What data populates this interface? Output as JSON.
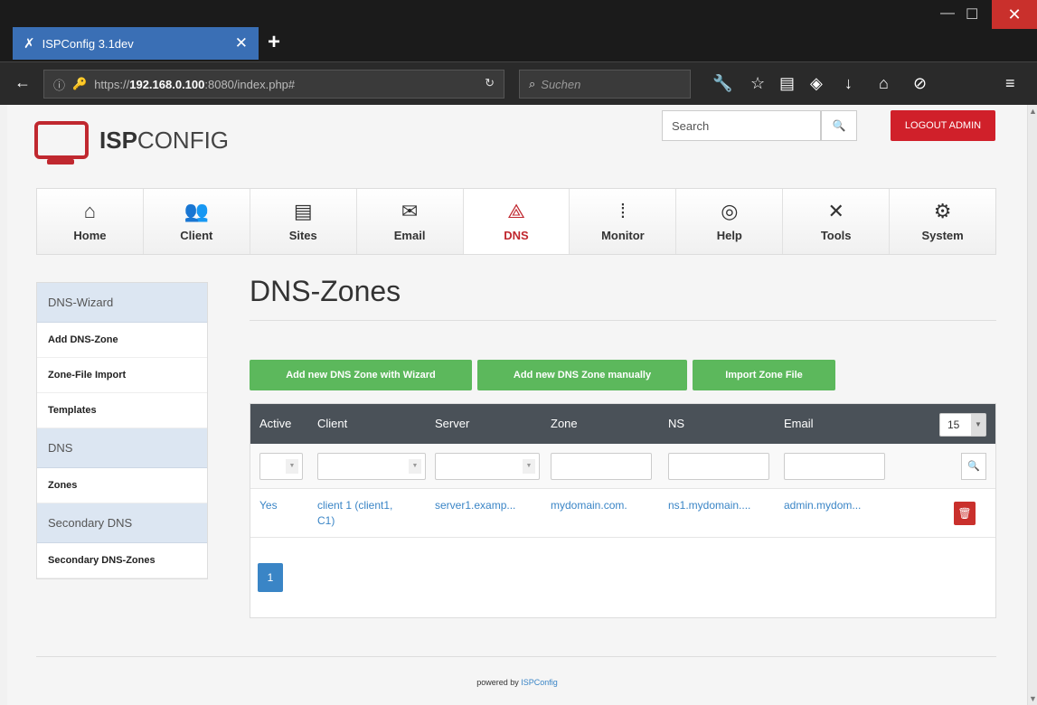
{
  "browser": {
    "tab_title": "ISPConfig 3.1dev",
    "url_prefix": "https://",
    "url_host": "192.168.0.100",
    "url_rest": ":8080/index.php#",
    "search_placeholder": "Suchen",
    "accent": "#3a6fb5"
  },
  "header": {
    "logo_bold": "ISP",
    "logo_rest": "CONFIG",
    "search_placeholder": "Search",
    "logout_label": "LOGOUT ADMIN"
  },
  "nav": {
    "items": [
      {
        "label": "Home",
        "icon": "home-icon"
      },
      {
        "label": "Client",
        "icon": "client-icon"
      },
      {
        "label": "Sites",
        "icon": "sites-icon"
      },
      {
        "label": "Email",
        "icon": "email-icon"
      },
      {
        "label": "DNS",
        "icon": "dns-icon",
        "active": true
      },
      {
        "label": "Monitor",
        "icon": "monitor-icon"
      },
      {
        "label": "Help",
        "icon": "help-icon"
      },
      {
        "label": "Tools",
        "icon": "tools-icon"
      },
      {
        "label": "System",
        "icon": "system-icon"
      }
    ]
  },
  "sidebar": {
    "sections": [
      {
        "heading": "DNS-Wizard",
        "items": [
          "Add DNS-Zone",
          "Zone-File Import",
          "Templates"
        ]
      },
      {
        "heading": "DNS",
        "items": [
          "Zones"
        ]
      },
      {
        "heading": "Secondary DNS",
        "items": [
          "Secondary DNS-Zones"
        ]
      }
    ]
  },
  "main": {
    "title": "DNS-Zones",
    "buttons": {
      "wizard": "Add new DNS Zone with Wizard",
      "manual": "Add new DNS Zone manually",
      "import": "Import Zone File"
    },
    "table": {
      "columns": [
        "Active",
        "Client",
        "Server",
        "Zone",
        "NS",
        "Email"
      ],
      "rows_per_page": "15",
      "rows": [
        {
          "active": "Yes",
          "client_line1": "client 1 (client1,",
          "client_line2": "C1)",
          "server": "server1.examp...",
          "zone": "mydomain.com.",
          "ns": "ns1.mydomain....",
          "email": "admin.mydom..."
        }
      ],
      "page": "1"
    }
  },
  "footer": {
    "prefix": "powered by",
    "brand": "ISPConfig"
  },
  "colors": {
    "brand_red": "#c0282f",
    "green": "#5cb85c",
    "link_blue": "#3a85c6",
    "table_header": "#4a5158"
  }
}
